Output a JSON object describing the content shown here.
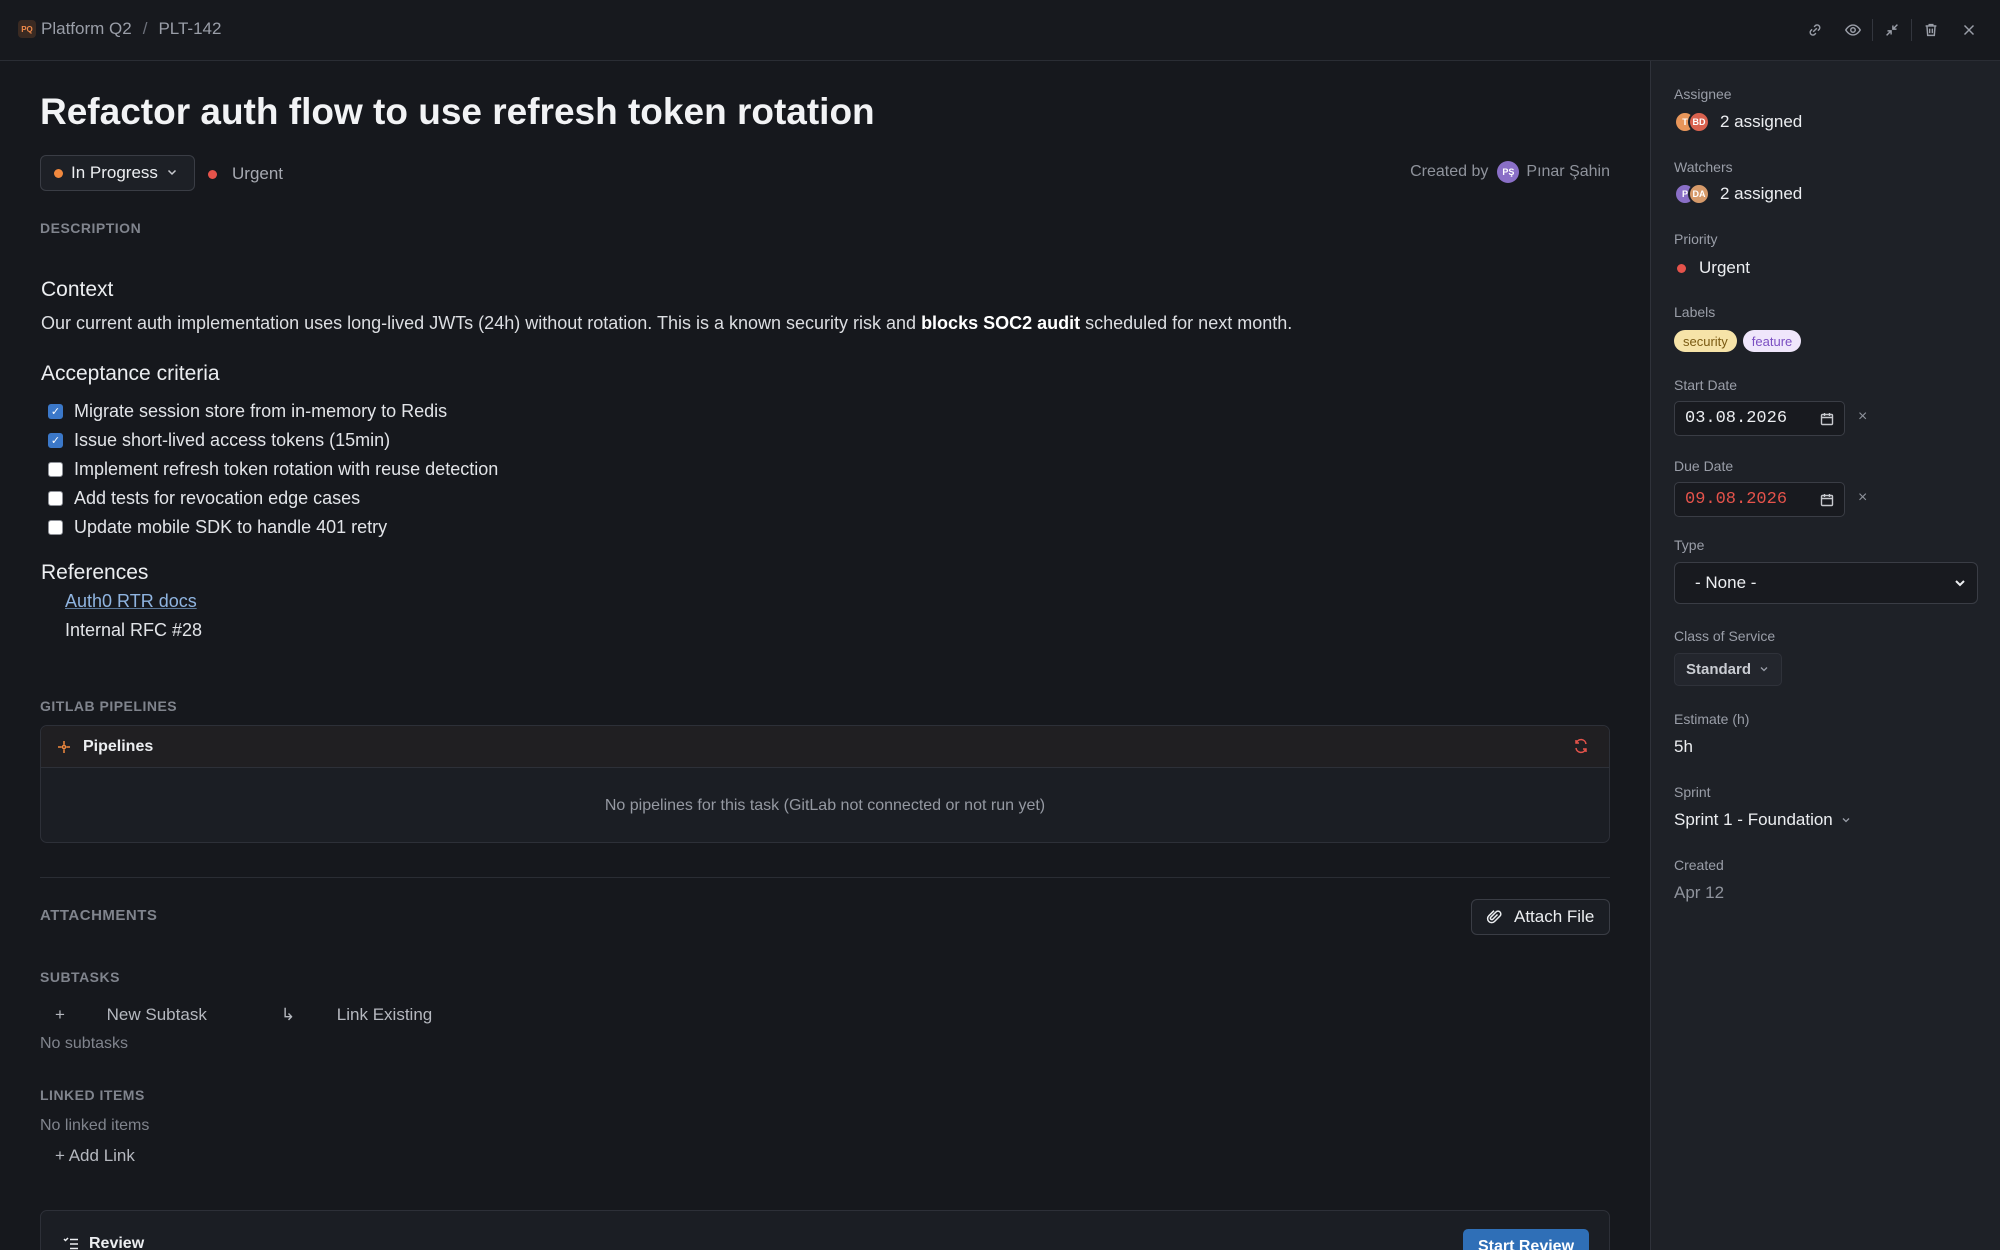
{
  "topbar": {
    "project_badge": "PQ",
    "project": "Platform Q2",
    "separator": "/",
    "task_id": "PLT-142",
    "icons": [
      "link-icon",
      "eye-icon",
      "collapse-icon",
      "trash-icon",
      "close-icon"
    ]
  },
  "task": {
    "title": "Refactor auth flow to use refresh token rotation",
    "status": "In Progress",
    "priority": "Urgent",
    "created_by_label": "Created by",
    "creator_initials": "PŞ",
    "creator": "Pınar Şahin"
  },
  "description": {
    "section_label": "DESCRIPTION",
    "context_heading": "Context",
    "context_text_1": "Our current auth implementation uses long-lived JWTs (24h) without rotation. This is a known security risk and ",
    "context_bold": "blocks SOC2 audit",
    "context_text_2": " scheduled for next month.",
    "criteria_heading": "Acceptance criteria",
    "criteria": [
      {
        "label": "Migrate session store from in-memory to Redis",
        "checked": true
      },
      {
        "label": "Issue short-lived access tokens (15min)",
        "checked": true
      },
      {
        "label": "Implement refresh token rotation with reuse detection",
        "checked": false
      },
      {
        "label": "Add tests for revocation edge cases",
        "checked": false
      },
      {
        "label": "Update mobile SDK to handle 401 retry",
        "checked": false
      }
    ],
    "references_heading": "References",
    "reference_link": "Auth0 RTR docs",
    "reference_plain": "Internal RFC #28"
  },
  "pipelines": {
    "section_label": "GITLAB PIPELINES",
    "title": "Pipelines",
    "empty": "No pipelines for this task (GitLab not connected or not run yet)"
  },
  "attachments": {
    "section_label": "ATTACHMENTS",
    "button": "Attach File"
  },
  "subtasks": {
    "section_label": "SUBTASKS",
    "new_button": "New Subtask",
    "link_button": "Link Existing",
    "empty": "No subtasks"
  },
  "linked": {
    "section_label": "LINKED ITEMS",
    "empty": "No linked items",
    "add_button": "Add Link"
  },
  "review": {
    "title": "Review",
    "button": "Start Review"
  },
  "panel": {
    "assignee_label": "Assignee",
    "assignee_avatars": [
      "T",
      "BD"
    ],
    "assignee_value": "2 assigned",
    "watchers_label": "Watchers",
    "watcher_avatars": [
      "P",
      "DA"
    ],
    "watchers_value": "2 assigned",
    "priority_label": "Priority",
    "priority_value": "Urgent",
    "labels_label": "Labels",
    "labels": [
      "security",
      "feature"
    ],
    "start_label": "Start Date",
    "start_value": "03.08.2026",
    "due_label": "Due Date",
    "due_value": "09.08.2026",
    "clear_symbol": "×",
    "type_label": "Type",
    "type_value": "- None -",
    "cos_label": "Class of Service",
    "cos_value": "Standard",
    "estimate_label": "Estimate (h)",
    "estimate_value": "5h",
    "sprint_label": "Sprint",
    "sprint_value": "Sprint 1 - Foundation",
    "created_label": "Created",
    "created_value": "Apr 12"
  },
  "colors": {
    "background": "#16181d",
    "panel": "#1e2127",
    "status_orange": "#f0883e",
    "urgent_red": "#e5534b",
    "primary_blue": "#2f6fb7",
    "due_overdue": "#e5534b"
  }
}
